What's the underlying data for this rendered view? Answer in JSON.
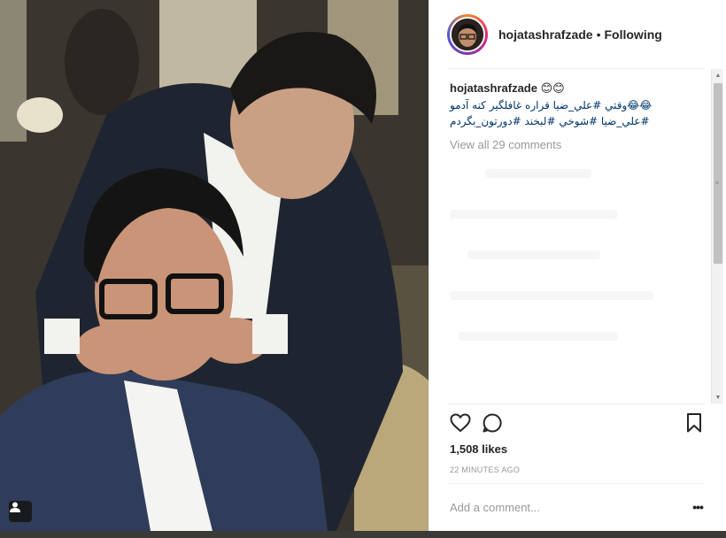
{
  "post": {
    "username": "hojatashrafzade",
    "separator": "•",
    "follow_status": "Following"
  },
  "caption": {
    "username": "hojatashrafzade",
    "emoji": "😊😊",
    "line1": "😂😂وقتي #علي_ضيا قراره غافلگير كنه آدمو",
    "line2": "#علي_ضيا #شوخي #لبخند #دورتون_بگردم",
    "view_all_comments": "View all 29 comments"
  },
  "actions": {
    "like_icon": "heart-icon",
    "comment_icon": "comment-icon",
    "save_icon": "bookmark-icon"
  },
  "likes": "1,508 likes",
  "timestamp": "22 MINUTES AGO",
  "comment_box": {
    "placeholder": "Add a comment...",
    "more_label": "•••"
  },
  "photo": {
    "tag_icon": "user-tag-icon"
  },
  "colors": {
    "hashtag": "#003569",
    "secondary_text": "#999999",
    "primary_text": "#262626"
  }
}
